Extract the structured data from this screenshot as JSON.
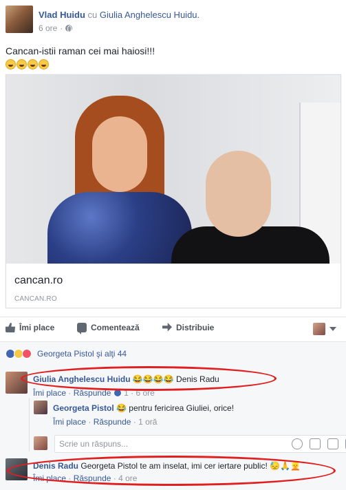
{
  "post": {
    "author": "Vlad Huidu",
    "with_word": "cu",
    "tagged": "Giulia Anghelescu Huidu.",
    "time": "6 ore",
    "separator": "·",
    "text": "Cancan-istii raman cei mai haiosi!!!",
    "emoji_count": 4,
    "emoji_icon": "laughing-emoji"
  },
  "link_card": {
    "title": "cancan.ro",
    "domain": "CANCAN.RO"
  },
  "actions": {
    "like": "Îmi place",
    "comment": "Comentează",
    "share": "Distribuie"
  },
  "reactions": {
    "summary": "Georgeta Pistol şi alţi 44",
    "icons": [
      "like-icon",
      "haha-icon",
      "love-icon"
    ]
  },
  "comments": [
    {
      "author": "Giulia Anghelescu Huidu",
      "text": "😂😂😂😂 Denis Radu",
      "like_label": "Îmi place",
      "reply_label": "Răspunde",
      "like_count": "1",
      "time": "6 ore"
    },
    {
      "author": "Georgeta Pistol",
      "text": "😂 pentru fericirea Giuliei, orice!",
      "like_label": "Îmi place",
      "reply_label": "Răspunde",
      "time": "1 oră"
    },
    {
      "author": "Denis Radu",
      "text": "Georgeta Pistol te am inselat, imi cer iertare public! 😓🙏👱",
      "like_label": "Îmi place",
      "reply_label": "Răspunde",
      "time": "4 ore"
    }
  ],
  "reply_input": {
    "placeholder": "Scrie un răspuns..."
  },
  "colors": {
    "link_blue": "#365899",
    "highlight_red": "#e02020",
    "meta_gray": "#90949c"
  }
}
